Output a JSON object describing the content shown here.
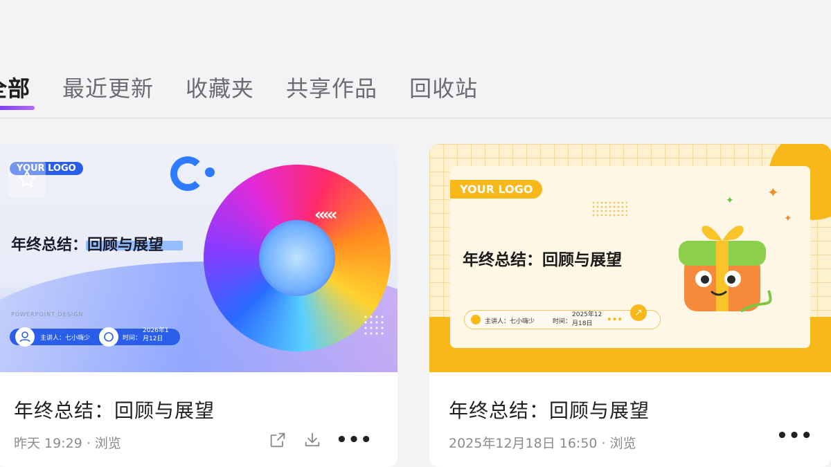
{
  "tabs": [
    {
      "label": "全部",
      "active": true
    },
    {
      "label": "最近更新",
      "active": false
    },
    {
      "label": "收藏夹",
      "active": false
    },
    {
      "label": "共享作品",
      "active": false
    },
    {
      "label": "回收站",
      "active": false
    }
  ],
  "colors": {
    "accent": "#7a3bff",
    "card1_brand": "#2a5ee8",
    "card2_brand": "#f9b81a"
  },
  "cards": [
    {
      "title": "年终总结：回顾与展望",
      "meta": "昨天 19:29 · 浏览",
      "thumbnail": {
        "logo": "YOUR LOGO",
        "headline": "年终总结：回顾与展望",
        "subtitle": "POWERPOINT DESIGN",
        "speaker": "主讲人：七小嗨少",
        "time_label": "时间：",
        "date_line1": "2026年1",
        "date_line2": "月12日"
      },
      "actions": [
        "share-icon",
        "download-icon",
        "more-icon"
      ]
    },
    {
      "title": "年终总结：回顾与展望",
      "meta": "2025年12月18日 16:50 · 浏览",
      "thumbnail": {
        "logo": "YOUR LOGO",
        "headline": "年终总结：回顾与展望",
        "speaker": "主讲人：七小嗨少",
        "time_label": "时间：",
        "date_line1": "2025年12",
        "date_line2": "月18日"
      },
      "actions": [
        "more-icon"
      ]
    }
  ]
}
